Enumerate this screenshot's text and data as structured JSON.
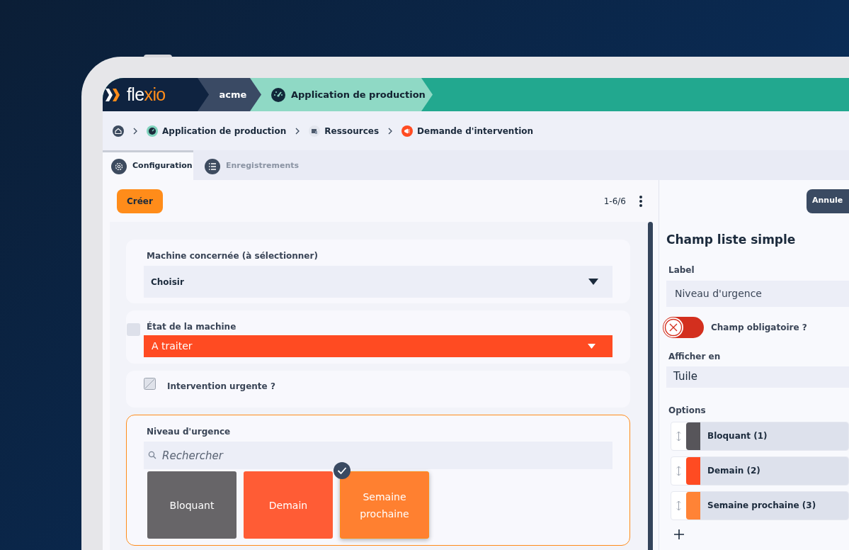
{
  "header": {
    "logo_text": "flexio",
    "segments": [
      {
        "label": "acme",
        "kind": "plain"
      },
      {
        "label": "Application de production",
        "kind": "app"
      }
    ]
  },
  "breadcrumb": [
    {
      "label": "Application de production",
      "kind": "app"
    },
    {
      "label": "Ressources",
      "kind": "resources"
    },
    {
      "label": "Demande d'intervention",
      "kind": "request"
    }
  ],
  "tabs": [
    {
      "label": "Configuration",
      "selected": true
    },
    {
      "label": "Enregistrements",
      "selected": false
    }
  ],
  "toolbar": {
    "create_button": "Créer",
    "pagination": "1-6/6"
  },
  "form": {
    "fields": [
      {
        "kind": "select",
        "label": "Machine concernée (à sélectionner)",
        "value": "Choisir"
      },
      {
        "kind": "status",
        "label": "État de la machine",
        "value": "A traiter"
      },
      {
        "kind": "checkbox",
        "label": "Intervention urgente ?",
        "checked": false
      },
      {
        "kind": "tiles",
        "label": "Niveau d'urgence",
        "placeholder": "Rechercher",
        "options": [
          {
            "label": "Bloquant",
            "color": "#676568",
            "selected": false
          },
          {
            "label": "Demain",
            "color": "#ff5c35",
            "selected": false
          },
          {
            "label": "Semaine prochaine",
            "color": "#ff8030",
            "selected": true
          }
        ]
      }
    ]
  },
  "panel": {
    "cancel_button": "Annule",
    "title": "Champ liste simple",
    "label_field": {
      "label": "Label",
      "value": "Niveau d'urgence"
    },
    "required_toggle": {
      "label": "Champ obligatoire ?",
      "on": false
    },
    "display": {
      "label": "Afficher en",
      "value": "Tuile"
    },
    "options": {
      "label": "Options",
      "items": [
        {
          "label": "Bloquant (1)",
          "color": "#57555a"
        },
        {
          "label": "Demain (2)",
          "color": "#ff4b22"
        },
        {
          "label": "Semaine prochaine (3)",
          "color": "#ff8336"
        }
      ]
    }
  }
}
